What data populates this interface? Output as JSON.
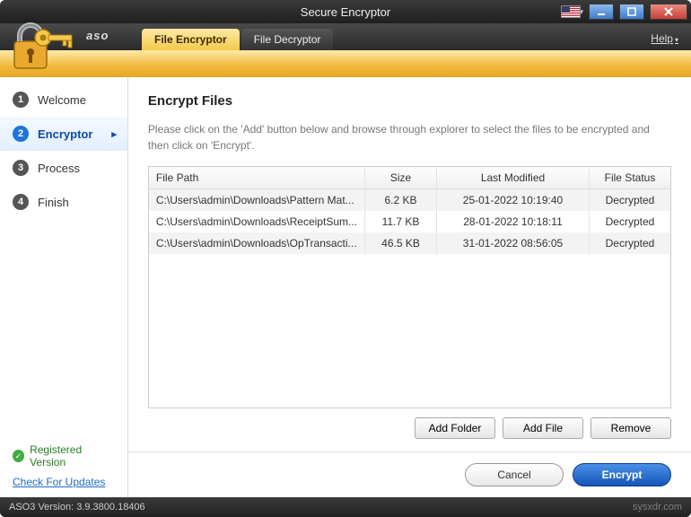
{
  "window": {
    "title": "Secure Encryptor"
  },
  "brand": "aso",
  "tabs": {
    "encryptor": "File Encryptor",
    "decryptor": "File Decryptor"
  },
  "help_label": "Help",
  "sidebar": {
    "steps": [
      {
        "num": "1",
        "label": "Welcome"
      },
      {
        "num": "2",
        "label": "Encryptor"
      },
      {
        "num": "3",
        "label": "Process"
      },
      {
        "num": "4",
        "label": "Finish"
      }
    ],
    "registered": "Registered Version",
    "updates": "Check For Updates"
  },
  "main": {
    "heading": "Encrypt Files",
    "instruction": "Please click on the 'Add' button below and browse through explorer to select the files to be encrypted and then click on 'Encrypt'."
  },
  "table": {
    "headers": {
      "path": "File Path",
      "size": "Size",
      "mod": "Last Modified",
      "status": "File Status"
    },
    "rows": [
      {
        "path": "C:\\Users\\admin\\Downloads\\Pattern Mat...",
        "size": "6.2 KB",
        "mod": "25-01-2022 10:19:40",
        "status": "Decrypted"
      },
      {
        "path": "C:\\Users\\admin\\Downloads\\ReceiptSum...",
        "size": "11.7 KB",
        "mod": "28-01-2022 10:18:11",
        "status": "Decrypted"
      },
      {
        "path": "C:\\Users\\admin\\Downloads\\OpTransacti...",
        "size": "46.5 KB",
        "mod": "31-01-2022 08:56:05",
        "status": "Decrypted"
      }
    ]
  },
  "buttons": {
    "add_folder": "Add Folder",
    "add_file": "Add File",
    "remove": "Remove",
    "cancel": "Cancel",
    "encrypt": "Encrypt"
  },
  "statusbar": {
    "version": "ASO3 Version: 3.9.3800.18406",
    "watermark": "sysxdr.com"
  }
}
